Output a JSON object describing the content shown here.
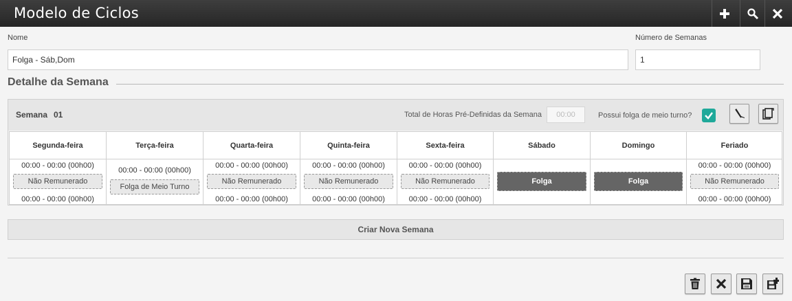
{
  "header": {
    "title": "Modelo de Ciclos"
  },
  "form": {
    "nome_label": "Nome",
    "nome_value": "Folga - Sáb,Dom",
    "semanas_label": "Número de Semanas",
    "semanas_value": "1"
  },
  "section": {
    "title": "Detalhe da Semana"
  },
  "week": {
    "name": "Semana",
    "number": "01",
    "hours_label": "Total de Horas Pré-Definidas da Semana",
    "hours_placeholder": "00:00",
    "half_shift_label": "Possui folga de meio turno?",
    "half_shift_checked": true,
    "days": [
      {
        "name": "Segunda-feira",
        "top": "00:00 - 00:00 (00h00)",
        "status": "Não Remunerado",
        "bottom": "00:00 - 00:00 (00h00)"
      },
      {
        "name": "Terça-feira",
        "top": "00:00 - 00:00 (00h00)",
        "status": "Folga de Meio Turno",
        "bottom": ""
      },
      {
        "name": "Quarta-feira",
        "top": "00:00 - 00:00 (00h00)",
        "status": "Não Remunerado",
        "bottom": "00:00 - 00:00 (00h00)"
      },
      {
        "name": "Quinta-feira",
        "top": "00:00 - 00:00 (00h00)",
        "status": "Não Remunerado",
        "bottom": "00:00 - 00:00 (00h00)"
      },
      {
        "name": "Sexta-feira",
        "top": "00:00 - 00:00 (00h00)",
        "status": "Não Remunerado",
        "bottom": "00:00 - 00:00 (00h00)"
      },
      {
        "name": "Sábado",
        "top": "",
        "status": "Folga",
        "bottom": ""
      },
      {
        "name": "Domingo",
        "top": "",
        "status": "Folga",
        "bottom": ""
      },
      {
        "name": "Feriado",
        "top": "00:00 - 00:00 (00h00)",
        "status": "Não Remunerado",
        "bottom": "00:00 - 00:00 (00h00)"
      }
    ]
  },
  "actions": {
    "new_week_label": "Criar Nova Semana"
  },
  "colors": {
    "accent": "#1fa99a",
    "titlebar": "#2f2f2f",
    "folga": "#656565"
  }
}
